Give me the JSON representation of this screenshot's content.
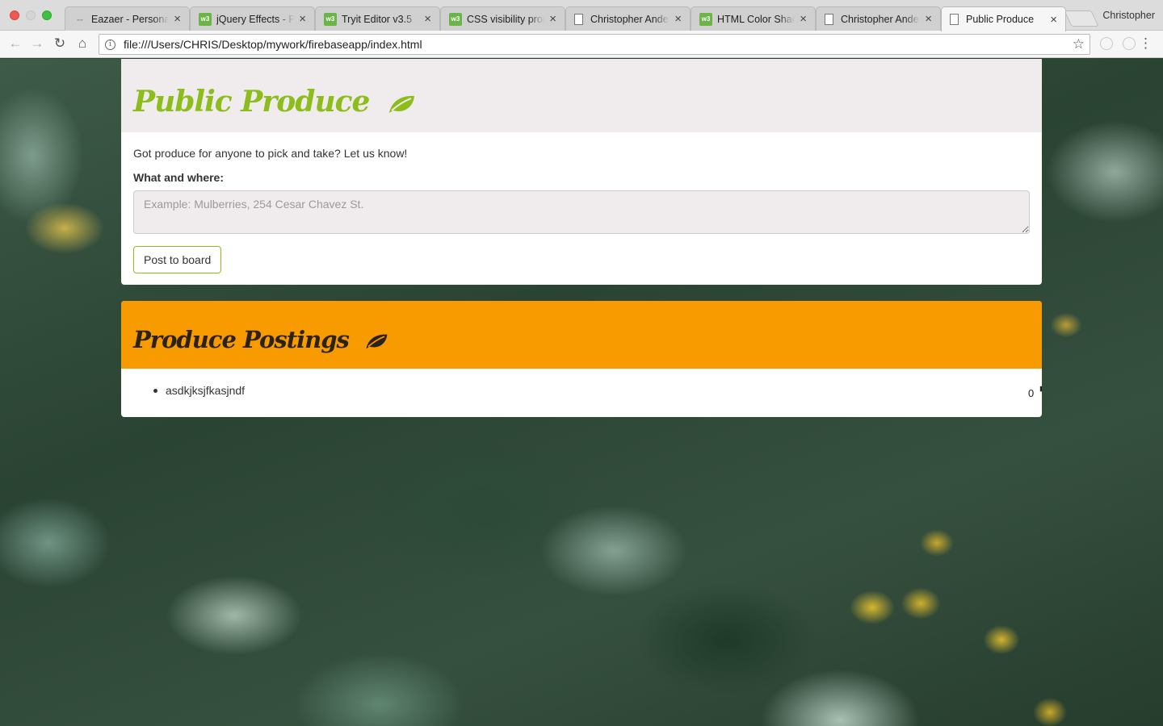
{
  "browser": {
    "tabs": [
      {
        "title": "Eazaer - Personal",
        "favicon": "dash-favicon",
        "active": false
      },
      {
        "title": "jQuery Effects - F",
        "favicon": "w3schools-favicon",
        "active": false
      },
      {
        "title": "Tryit Editor v3.5",
        "favicon": "w3schools-favicon",
        "active": false
      },
      {
        "title": "CSS visibility prop",
        "favicon": "w3schools-favicon",
        "active": false
      },
      {
        "title": "Christopher Ande",
        "favicon": "page-favicon",
        "active": false
      },
      {
        "title": "HTML Color Shad",
        "favicon": "w3schools-favicon",
        "active": false
      },
      {
        "title": "Christopher Ande",
        "favicon": "page-favicon",
        "active": false
      },
      {
        "title": "Public Produce",
        "favicon": "page-favicon",
        "active": true
      }
    ],
    "favicon_text": "w3",
    "profile_name": "Christopher",
    "url": "file:///Users/CHRIS/Desktop/mywork/firebaseapp/index.html",
    "icons": {
      "close": "×",
      "back": "←",
      "forward": "→",
      "reload": "↻",
      "home": "⌂",
      "star": "☆",
      "menu": "⋮",
      "info": "i"
    }
  },
  "app": {
    "title": "Public Produce",
    "intro": "Got produce for anyone to pick and take? Let us know!",
    "field_label": "What and where:",
    "textarea_placeholder": "Example: Mulberries, 254 Cesar Chavez St.",
    "textarea_value": "",
    "post_button": "Post to board",
    "postings_title": "Produce Postings",
    "postings": [
      {
        "text": "asdkjksjfkasjndf",
        "count": "0"
      }
    ],
    "colors": {
      "title_green": "#8dbd1c",
      "header_light": "#f0eced",
      "header_orange": "#f89b00",
      "postings_title": "#2b2211"
    }
  }
}
